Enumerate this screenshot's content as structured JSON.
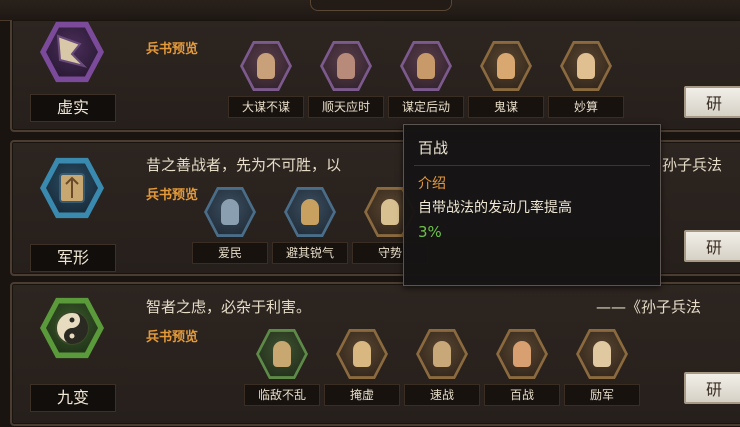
{
  "sections": [
    {
      "name": "虚实",
      "color": "purple",
      "quote": "",
      "preview_label": "兵书预览",
      "skills": [
        {
          "name": "大谋不谋",
          "tier": "purple"
        },
        {
          "name": "顺天应时",
          "tier": "purple"
        },
        {
          "name": "谋定后动",
          "tier": "purple"
        },
        {
          "name": "鬼谋",
          "tier": "gold"
        },
        {
          "name": "妙算",
          "tier": "gold"
        }
      ],
      "research_label": "研"
    },
    {
      "name": "军形",
      "color": "blue",
      "quote": "昔之善战者，先为不可胜，以",
      "quote_source": "孙子兵法",
      "preview_label": "兵书预览",
      "skills": [
        {
          "name": "爱民",
          "tier": "blue"
        },
        {
          "name": "避其锐气",
          "tier": "blue"
        },
        {
          "name": "守势",
          "tier": "gold"
        }
      ],
      "research_label": "研"
    },
    {
      "name": "九变",
      "color": "green",
      "quote": "智者之虑，必杂于利害。",
      "quote_source": "——《孙子兵法",
      "preview_label": "兵书预览",
      "skills": [
        {
          "name": "临敌不乱",
          "tier": "green"
        },
        {
          "name": "掩虚",
          "tier": "gold"
        },
        {
          "name": "速战",
          "tier": "gold"
        },
        {
          "name": "百战",
          "tier": "gold"
        },
        {
          "name": "励军",
          "tier": "gold"
        }
      ],
      "research_label": "研"
    }
  ],
  "tooltip": {
    "title": "百战",
    "section_label": "介绍",
    "description": "自带战法的发动几率提高",
    "value": "3%"
  },
  "colors": {
    "accent_orange": "#e49a3a",
    "value_green": "#6cc24a"
  }
}
